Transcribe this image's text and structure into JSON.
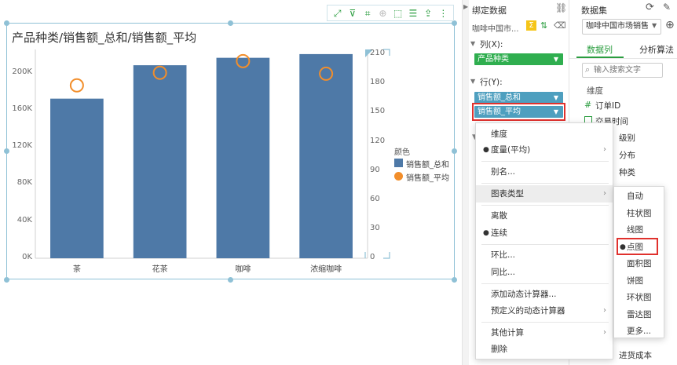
{
  "chart": {
    "toolbar_icons": [
      "expand-icon",
      "filter-icon",
      "crop-icon",
      "zoom-icon",
      "cursor-select-icon",
      "list-icon",
      "export-icon",
      "more-icon"
    ]
  },
  "chart_data": {
    "type": "bar",
    "title": "产品种类/销售额_总和/销售额_平均",
    "categories": [
      "茶",
      "花茶",
      "咖啡",
      "浓缩咖啡"
    ],
    "series": [
      {
        "name": "销售额_总和",
        "values": [
          172000,
          208000,
          216000,
          220000
        ],
        "type": "bar",
        "axis": "left",
        "color": "#4e79a7"
      },
      {
        "name": "销售额_平均",
        "values": [
          178,
          191,
          203,
          190
        ],
        "type": "scatter",
        "axis": "right",
        "color": "#f28e2b"
      }
    ],
    "y_left": {
      "ticks": [
        "0K",
        "40K",
        "80K",
        "120K",
        "160K",
        "200K"
      ],
      "range": [
        0,
        225000
      ]
    },
    "y_right": {
      "ticks": [
        "0",
        "30",
        "60",
        "90",
        "120",
        "150",
        "180",
        "210"
      ],
      "range": [
        0,
        215
      ]
    },
    "legend": {
      "title": "颜色",
      "position": "right"
    }
  },
  "bind": {
    "title": "绑定数据",
    "dataset_name": "咖啡中国市...",
    "col_label": "列(X):",
    "col_field": "产品种类",
    "row_label": "行(Y):",
    "row_fields": [
      "销售额_总和",
      "销售额_平均"
    ],
    "fragments": [
      "维度",
      "订单ID",
      "交易时间",
      "级别",
      "分布",
      "种类",
      "进货成本"
    ]
  },
  "dataset": {
    "title": "数据集",
    "selected": "咖啡中国市场销售",
    "tabs": [
      "数据列",
      "分析算法"
    ],
    "search_placeholder": "输入搜索文字"
  },
  "context_menu": {
    "items": [
      "维度",
      "度量(平均)",
      "别名...",
      "图表类型",
      "离散",
      "连续",
      "环比...",
      "同比...",
      "添加动态计算器...",
      "预定义的动态计算器",
      "其他计算",
      "删除"
    ],
    "submenu": [
      "自动",
      "柱状图",
      "线图",
      "点图",
      "面积图",
      "饼图",
      "环状图",
      "雷达图",
      "更多..."
    ]
  },
  "colors": {
    "accent": "#2a9d3f",
    "highlight_border": "#e0312d",
    "row_pill": "#4e9fbf",
    "col_pill": "#2fae4f"
  }
}
